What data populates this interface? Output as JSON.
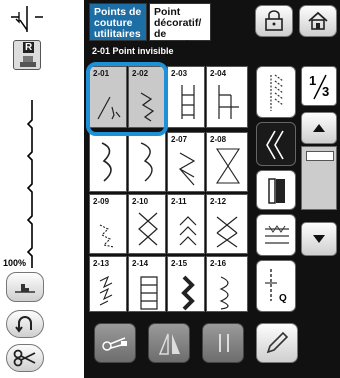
{
  "tabs": [
    {
      "label_line1": "Points de",
      "label_line2": "couture",
      "label_line3": "utilitaires",
      "active": true
    },
    {
      "label_line1": "Point",
      "label_line2": "décoratif/",
      "label_line3": "de caractère",
      "active": false
    }
  ],
  "left_panel": {
    "foot_letter": "R",
    "speed": "100%"
  },
  "stitch_title": "2-01 Point invisible",
  "stitches": [
    {
      "num": "2-01"
    },
    {
      "num": "2-02"
    },
    {
      "num": "2-03"
    },
    {
      "num": "2-04"
    },
    {
      "num": ""
    },
    {
      "num": ""
    },
    {
      "num": "2-07"
    },
    {
      "num": "2-08"
    },
    {
      "num": "2-09"
    },
    {
      "num": "2-10"
    },
    {
      "num": "2-11"
    },
    {
      "num": "2-12"
    },
    {
      "num": "2-13"
    },
    {
      "num": "2-14"
    },
    {
      "num": "2-15"
    },
    {
      "num": "2-16"
    }
  ],
  "page_indicator": {
    "current": "1",
    "total": "3"
  },
  "side_q_letter": "Q",
  "icons": {
    "needle": "needle-icon",
    "home": "home-icon",
    "lock": "lock-icon",
    "presser_foot": "presser-foot-icon",
    "reverse": "reverse-icon",
    "cut": "scissors-icon"
  },
  "colors": {
    "selection": "#1e90d8",
    "panel": "#111111",
    "header_blue": "#cde2ef"
  }
}
